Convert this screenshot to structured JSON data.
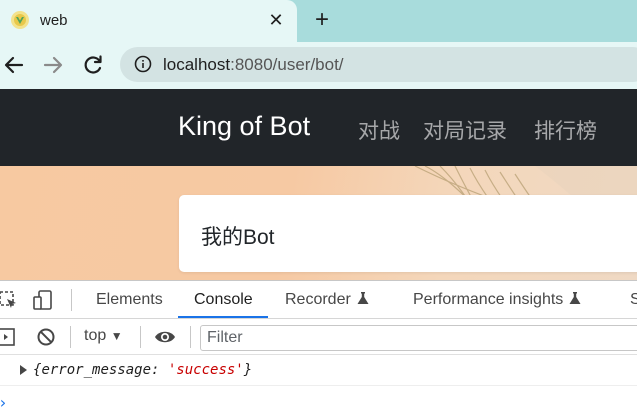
{
  "browser": {
    "tab": {
      "title": "web",
      "close_glyph": "✕"
    },
    "new_tab_glyph": "+",
    "url": {
      "host": "localhost",
      "rest": ":8080/user/bot/"
    }
  },
  "page": {
    "navbar": {
      "brand": "King of Bot",
      "links": [
        "对战",
        "对局记录",
        "排行榜"
      ]
    },
    "card": {
      "header": "我的Bot"
    }
  },
  "devtools": {
    "tabs": [
      "Elements",
      "Console",
      "Recorder",
      "Performance insights",
      "S"
    ],
    "active_tab": "Console",
    "context": "top",
    "context_arrow": "▼",
    "filter_placeholder": "Filter",
    "log": {
      "open_brace": "{",
      "key": "error_message",
      "colon": ": ",
      "value": "'success'",
      "close_brace": "}"
    },
    "prompt_glyph": "›",
    "accent_color": "#1a73e8"
  }
}
